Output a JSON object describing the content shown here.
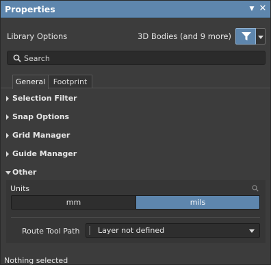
{
  "window": {
    "title": "Properties"
  },
  "header": {
    "library_options_label": "Library Options",
    "filter_summary": "3D Bodies (and 9 more)",
    "filter_icon": "funnel-icon",
    "filter_dropdown_icon": "chevron-down-icon"
  },
  "search": {
    "placeholder": "Search",
    "value": "",
    "icon": "search-icon"
  },
  "tabs": [
    {
      "label": "General",
      "active": true
    },
    {
      "label": "Footprint",
      "active": false
    }
  ],
  "sections": [
    {
      "label": "Selection Filter",
      "expanded": false
    },
    {
      "label": "Snap Options",
      "expanded": false
    },
    {
      "label": "Grid Manager",
      "expanded": false
    },
    {
      "label": "Guide Manager",
      "expanded": false
    },
    {
      "label": "Other",
      "expanded": true
    }
  ],
  "other": {
    "units_label": "Units",
    "units_options": [
      "mm",
      "mils"
    ],
    "units_selected": "mils",
    "route_tool_path_label": "Route Tool Path",
    "route_tool_path_value": "Layer not defined"
  },
  "status": {
    "text": "Nothing selected"
  },
  "colors": {
    "accent": "#5e86ad",
    "panel_bg": "#3c3c3c",
    "field_bg": "#2e2e2e"
  }
}
